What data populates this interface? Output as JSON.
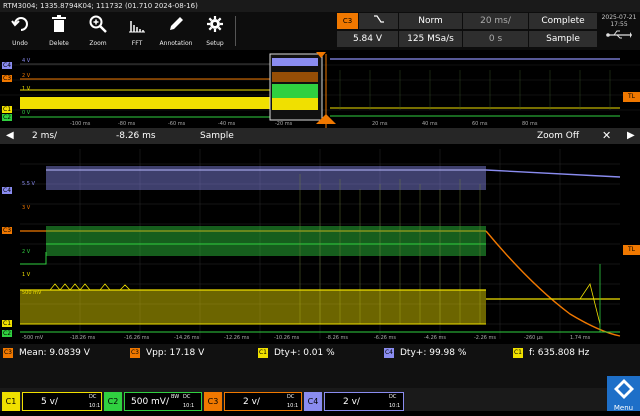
{
  "window_title": "RTM3004; 1335.8794K04; 111732 (01.710 2024-08-16)",
  "toolbar": {
    "undo": "Undo",
    "delete": "Delete",
    "zoom": "Zoom",
    "fft": "FFT",
    "annotation": "Annotation",
    "setup": "Setup"
  },
  "acquisition": {
    "trigger_source": "C3",
    "trigger_slope_icon": "falling-edge-icon",
    "trigger_mode": "Norm",
    "timebase": "20 ms/",
    "acq_state": "Complete",
    "trigger_level": "5.84 V",
    "sample_rate": "125 MSa/s",
    "position": "0 s",
    "acq_mode": "Sample"
  },
  "datetime": {
    "date": "2025-07-21",
    "time": "17:55"
  },
  "overview": {
    "ch_labels": [
      "C4",
      "C3",
      "C1",
      "C2"
    ],
    "level_labels": [
      "4 V",
      "2 V",
      "1 V",
      "0 V"
    ],
    "trigger_marker": "TL",
    "x_ticks": [
      "-100 ms",
      "-80 ms",
      "-60 ms",
      "-40 ms",
      "-20 ms",
      "20 ms",
      "40 ms",
      "60 ms",
      "80 ms"
    ]
  },
  "zoom_window": {
    "timebase": "2 ms/",
    "position": "-8.26 ms",
    "mode": "Sample",
    "zoom_off": "Zoom Off"
  },
  "main_plot": {
    "level_labels": [
      "5.5 V",
      "3 V",
      "2 V",
      "1 V",
      "500 mV",
      "-500 mV"
    ],
    "ch_labels": [
      "C4",
      "C3",
      "C1",
      "C2"
    ],
    "trigger_marker": "TL",
    "x_ticks": [
      "-500 mV",
      "-18.26 ms",
      "-16.26 ms",
      "-14.26 ms",
      "-12.26 ms",
      "-10.26 ms",
      "-8.26 ms",
      "-6.26 ms",
      "-4.26 ms",
      "-2.26 ms",
      "-260 µs",
      "1.74 ms"
    ]
  },
  "measurements": [
    {
      "ch": "C3",
      "text": "Mean: 9.0839 V",
      "color": "#f07800"
    },
    {
      "ch": "C3",
      "text": "Vpp: 17.18 V",
      "color": "#f07800"
    },
    {
      "ch": "C1",
      "text": "Dty+: 0.01 %",
      "color": "#f0e000"
    },
    {
      "ch": "C4",
      "text": "Dty+: 99.98 %",
      "color": "#8a8cf0"
    },
    {
      "ch": "C1",
      "text": "f: 635.808 Hz",
      "color": "#f0e000"
    }
  ],
  "channels": [
    {
      "name": "C1",
      "scale": "5 v/",
      "coupling": "DC",
      "probe": "10:1",
      "color": "#f0e000"
    },
    {
      "name": "C2",
      "scale": "500 mV/",
      "coupling": "DC",
      "probe": "10:1",
      "color": "#30d040",
      "extra": "BW"
    },
    {
      "name": "C3",
      "scale": "2 v/",
      "coupling": "DC",
      "probe": "10:1",
      "color": "#f07800"
    },
    {
      "name": "C4",
      "scale": "2 v/",
      "coupling": "DC",
      "probe": "10:1",
      "color": "#8a8cf0"
    }
  ],
  "menu_label": "Menu",
  "colors": {
    "c1": "#f0e000",
    "c2": "#30d040",
    "c3": "#f07800",
    "c4": "#8a8cf0"
  }
}
